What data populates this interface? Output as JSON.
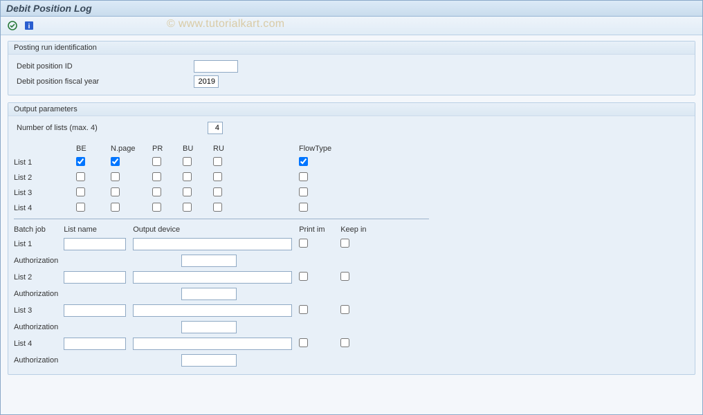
{
  "header": {
    "title": "Debit Position Log"
  },
  "watermark": "© www.tutorialkart.com",
  "toolbar": {
    "execute_icon": "execute-icon",
    "info_icon": "info-icon"
  },
  "group_posting": {
    "title": "Posting run identification",
    "debit_id_label": "Debit position ID",
    "debit_id_value": "",
    "fiscal_year_label": "Debit position fiscal year",
    "fiscal_year_value": "2019"
  },
  "group_output": {
    "title": "Output parameters",
    "numlists_label": "Number of lists (max. 4)",
    "numlists_value": "4",
    "cols": {
      "be": "BE",
      "npage": "N.page",
      "pr": "PR",
      "bu": "BU",
      "ru": "RU",
      "flow": "FlowType"
    },
    "rows": [
      {
        "label": "List 1",
        "be": true,
        "npage": true,
        "pr": false,
        "bu": false,
        "ru": false,
        "flow": true
      },
      {
        "label": "List 2",
        "be": false,
        "npage": false,
        "pr": false,
        "bu": false,
        "ru": false,
        "flow": false
      },
      {
        "label": "List 3",
        "be": false,
        "npage": false,
        "pr": false,
        "bu": false,
        "ru": false,
        "flow": false
      },
      {
        "label": "List 4",
        "be": false,
        "npage": false,
        "pr": false,
        "bu": false,
        "ru": false,
        "flow": false
      }
    ],
    "batch_headers": {
      "batch": "Batch job",
      "listname": "List name",
      "device": "Output device",
      "print": "Print im",
      "keep": "Keep in"
    },
    "auth_label": "Authorization",
    "batch_rows": [
      {
        "label": "List 1",
        "listname": "",
        "device": "",
        "print": false,
        "keep": false,
        "auth": ""
      },
      {
        "label": "List 2",
        "listname": "",
        "device": "",
        "print": false,
        "keep": false,
        "auth": ""
      },
      {
        "label": "List 3",
        "listname": "",
        "device": "",
        "print": false,
        "keep": false,
        "auth": ""
      },
      {
        "label": "List 4",
        "listname": "",
        "device": "",
        "print": false,
        "keep": false,
        "auth": ""
      }
    ]
  }
}
